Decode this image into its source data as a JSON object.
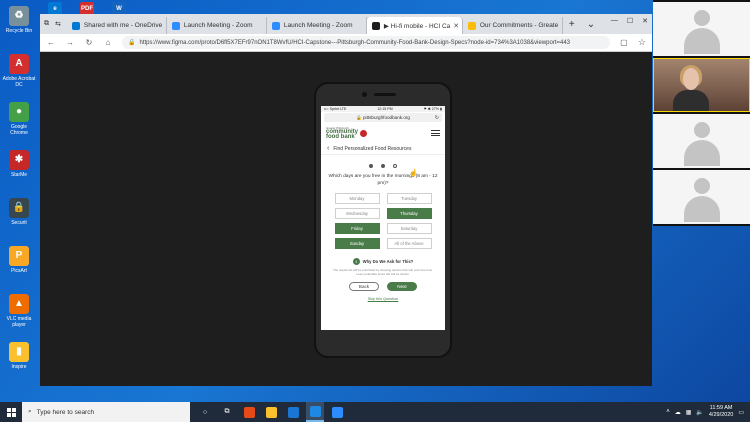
{
  "desktop": {
    "icons": [
      {
        "label": "Recycle Bin",
        "color": "#78909c",
        "glyph": "♻"
      },
      {
        "label": "Adobe Acrobat DC",
        "color": "#d32f2f",
        "glyph": "A"
      },
      {
        "label": "Google Chrome",
        "color": "#43a047",
        "glyph": "●"
      },
      {
        "label": "StarMe",
        "color": "#c62828",
        "glyph": "✱"
      },
      {
        "label": "Securit",
        "color": "#37474f",
        "glyph": "🔒"
      },
      {
        "label": "PicsArt",
        "color": "#f9a825",
        "glyph": "P"
      },
      {
        "label": "VLC media player",
        "color": "#ef6c00",
        "glyph": "▲"
      },
      {
        "label": "Inspire",
        "color": "#fbc02d",
        "glyph": "▮"
      }
    ],
    "top_icons": [
      "e",
      "PDF",
      "W"
    ]
  },
  "browser": {
    "tabs": [
      {
        "label": "Shared with me - OneDrive",
        "color": "#0078d4",
        "active": false
      },
      {
        "label": "Launch Meeting - Zoom",
        "color": "#2d8cff",
        "active": false
      },
      {
        "label": "Launch Meeting - Zoom",
        "color": "#2d8cff",
        "active": false
      },
      {
        "label": "▶ Hi-fi mobile - HCI Ca",
        "color": "#1e1e1e",
        "active": true
      },
      {
        "label": "Our Commitments - Greate",
        "color": "#fbbc05",
        "active": false
      }
    ],
    "new_tab": "+",
    "url": "https://www.figma.com/proto/D6fl5X7EFr97nON1T8WvfU/HCI-Capstone---Pittsburgh-Community-Food-Bank-Design-Specs?node-id=734%3A1038&viewport=443",
    "window_controls": [
      "—",
      "☐",
      "✕"
    ]
  },
  "phone": {
    "status_left": "••○ Sprint  LTE",
    "status_center": "12:15 PM",
    "status_right": "⚑ ✱ 27% ▮",
    "address": "🔒 pittsburghfoodbank.org",
    "logo_line1": "community",
    "logo_line2": "food bank",
    "logo_sub": "Greater Pittsburgh",
    "page_title": "Find Personalized Food Resources",
    "question": "Which days are you free in the mornings (8 am - 12 pm)?",
    "days": [
      {
        "label": "Monday",
        "selected": false
      },
      {
        "label": "Tuesday",
        "selected": false
      },
      {
        "label": "Wednesday",
        "selected": false
      },
      {
        "label": "Thursday",
        "selected": true
      },
      {
        "label": "Friday",
        "selected": true
      },
      {
        "label": "Saturday",
        "selected": false
      },
      {
        "label": "Sunday",
        "selected": true
      },
      {
        "label": "All of the Above",
        "selected": false
      }
    ],
    "why_number": "i",
    "why_title": "Why Do We Ask for This?",
    "why_text": "The results list will be prioritized by showing options that suit your free time. Less preferable times will still be shown.",
    "back_label": "Back",
    "next_label": "Next",
    "skip_label": "Skip this Question"
  },
  "taskbar": {
    "search_placeholder": "Type here to search",
    "time": "11:59 AM",
    "date": "4/29/2020"
  }
}
